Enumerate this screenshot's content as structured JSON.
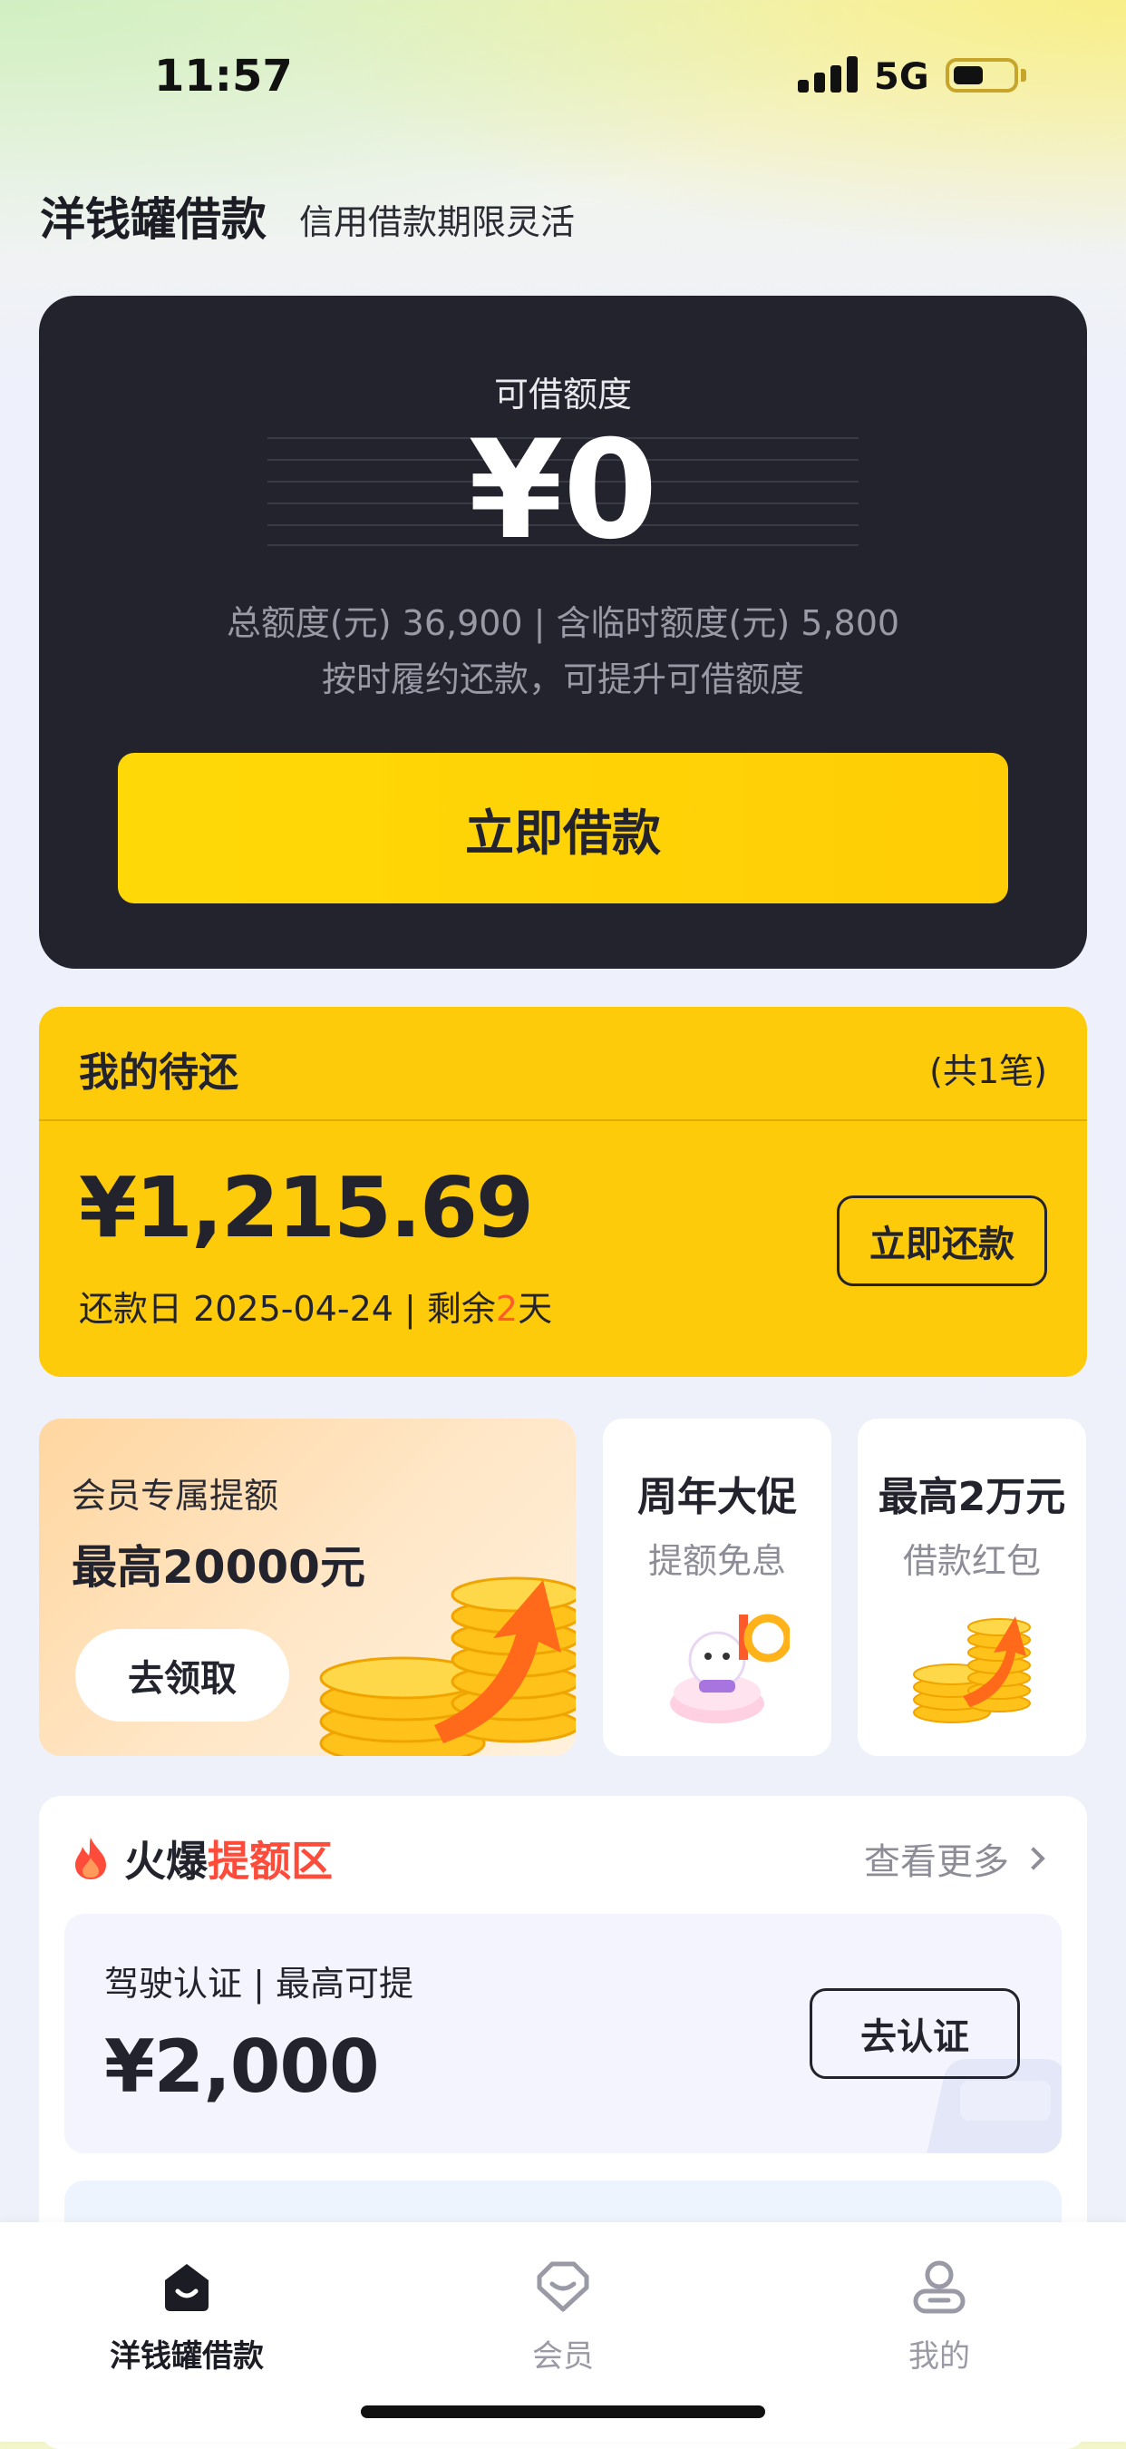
{
  "status_bar": {
    "time": "11:57",
    "network": "5G"
  },
  "header": {
    "title": "洋钱罐借款",
    "subtitle": "信用借款期限灵活"
  },
  "credit": {
    "label": "可借额度",
    "amount": "¥0",
    "total": "总额度(元) 36,900 | 含临时额度(元) 5,800",
    "tip": "按时履约还款，可提升可借额度",
    "borrow_button": "立即借款"
  },
  "repayment": {
    "title": "我的待还",
    "count": "(共1笔)",
    "amount": "¥1,215.69",
    "date_prefix": "还款日 2025-04-24 | 剩余",
    "days_left": "2",
    "date_suffix": "天",
    "button": "立即还款"
  },
  "promos": {
    "main": {
      "label": "会员专属提额",
      "value": "最高20000元",
      "button": "去领取"
    },
    "tiles": [
      {
        "title": "周年大促",
        "subtitle": "提额免息"
      },
      {
        "title": "最高2万元",
        "subtitle": "借款红包"
      }
    ]
  },
  "hot_section": {
    "title_prefix": "火爆",
    "title_accent": "提额区",
    "more": "查看更多",
    "card": {
      "label": "驾驶认证 | 最高可提",
      "amount": "¥2,000",
      "button": "去认证"
    }
  },
  "tab_bar": {
    "tabs": [
      {
        "label": "洋钱罐借款",
        "icon": "home-icon",
        "active": true
      },
      {
        "label": "会员",
        "icon": "member-icon",
        "active": false
      },
      {
        "label": "我的",
        "icon": "profile-icon",
        "active": false
      }
    ]
  },
  "colors": {
    "accent_yellow": "#FECB0A",
    "dark_card": "#23232D",
    "highlight_red": "#FF4B3A"
  }
}
